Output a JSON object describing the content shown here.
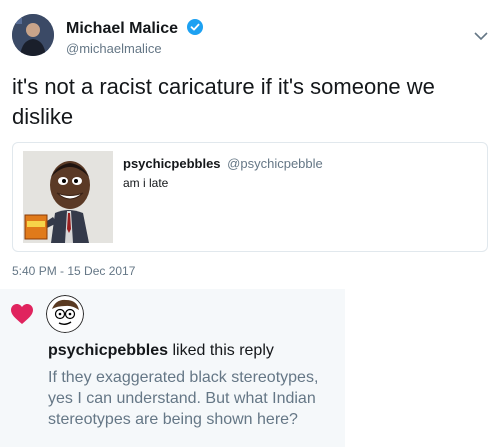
{
  "tweet": {
    "author_name": "Michael Malice",
    "author_handle": "@michaelmalice",
    "text": "it's not a racist caricature if it's someone we dislike",
    "timestamp": "5:40 PM - 15 Dec 2017"
  },
  "quote": {
    "author_name": "psychicpebbles",
    "author_handle": "@psychicpebble",
    "text": "am i late"
  },
  "notification": {
    "user": "psychicpebbles",
    "action": "liked this reply",
    "reply_text": "If they exaggerated black stereotypes, yes I can understand. But what Indian stereotypes are being shown here?"
  },
  "icons": {
    "verified": "verified-badge-icon",
    "caret": "chevron-down-icon",
    "like": "heart-icon"
  },
  "colors": {
    "verified": "#1da1f2",
    "heart": "#e0245e",
    "secondary_text": "#657786"
  }
}
